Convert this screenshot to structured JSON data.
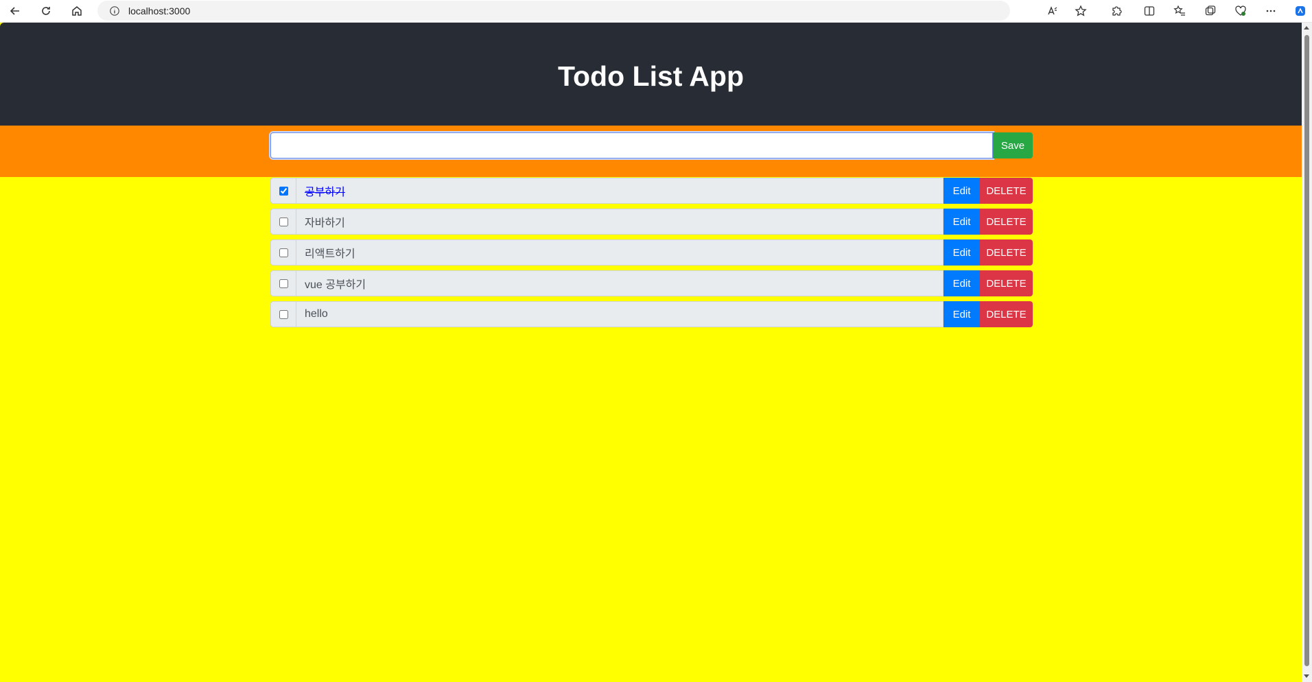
{
  "browser": {
    "url": "localhost:3000",
    "accent_color": "#1a73e8"
  },
  "app": {
    "title": "Todo List App",
    "header_color": "#282c34",
    "add_bar_color": "#ff8800",
    "list_bg_color": "#ffff00"
  },
  "form": {
    "input_value": "",
    "save_label": "Save"
  },
  "todos": [
    {
      "text": "공부하기",
      "completed": true,
      "edit_label": "Edit",
      "delete_label": "DELETE"
    },
    {
      "text": "자바하기",
      "completed": false,
      "edit_label": "Edit",
      "delete_label": "DELETE"
    },
    {
      "text": "리액트하기",
      "completed": false,
      "edit_label": "Edit",
      "delete_label": "DELETE"
    },
    {
      "text": "vue 공부하기",
      "completed": false,
      "edit_label": "Edit",
      "delete_label": "DELETE"
    },
    {
      "text": "hello",
      "completed": false,
      "edit_label": "Edit",
      "delete_label": "DELETE"
    }
  ]
}
